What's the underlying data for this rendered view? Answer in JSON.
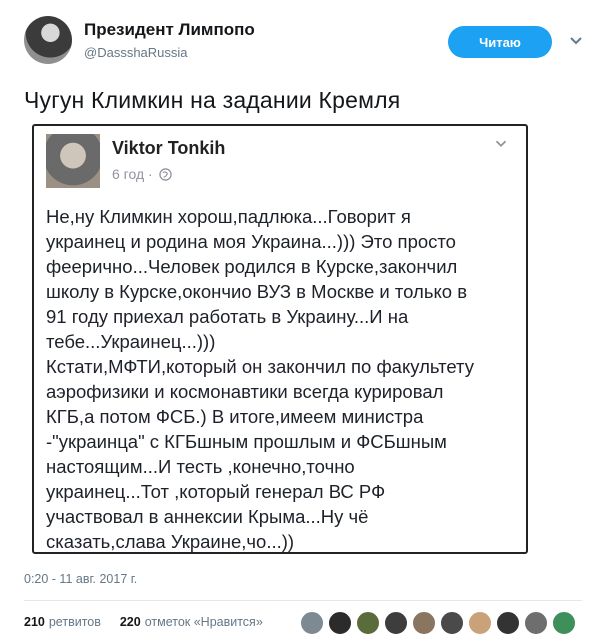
{
  "author": {
    "name": "Президент Лимпопо",
    "handle": "@DassshaRussia"
  },
  "follow_button_label": "Читаю",
  "tweet_text": "Чугун Климкин на задании Кремля",
  "embedded_post": {
    "author_name": "Viktor  Tonkih",
    "meta": "6 год ·",
    "lines": [
      "Не,ну Климкин хорош,падлюка...Говорит я",
      "украинец и родина моя Украина...))) Это просто",
      "феерично...Человек родился в Курске,закончил",
      "школу в Курске,окончио ВУЗ в Москве и только в",
      "91 году приехал работать в Украину...И на",
      "тебе...Украинец...)))",
      "Кстати,МФТИ,который он закончил по факультету",
      "аэрофизики и космонавтики всегда курировал",
      "КГБ,а потом ФСБ.) В итоге,имеем министра",
      "-\"украинца\" с КГБшным прошлым и ФСБшным",
      "настоящим...И тесть ,конечно,точно",
      "украинец...Тот ,который генерал ВС РФ",
      "участвовал в аннексии Крыма...Ну чё",
      "сказать,слава Украине,чо...))"
    ]
  },
  "timestamp": "0:20 - 11 авг. 2017 г.",
  "stats": {
    "retweets_count": "210",
    "retweets_label": "ретвитов",
    "likes_count": "220",
    "likes_label": "отметок «Нравится»"
  },
  "likers": [
    "#7d8a94",
    "#2b2b2b",
    "#5a6b3c",
    "#3d3d3d",
    "#8a7560",
    "#4a4a4a",
    "#c9a27a",
    "#333333",
    "#6e6e6e",
    "#3f8f5a"
  ],
  "colors": {
    "accent": "#1da1f2",
    "muted": "#657786"
  }
}
